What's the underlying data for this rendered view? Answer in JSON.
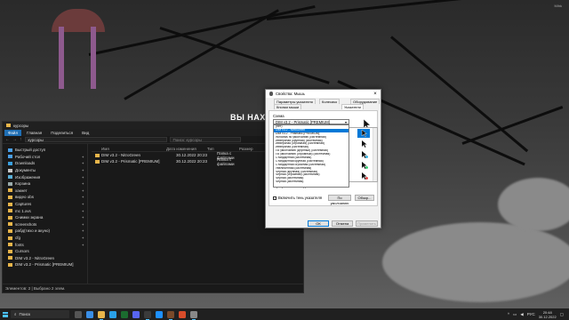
{
  "scene": {
    "title": "ВЫ НАХО",
    "watermark": "Mihk"
  },
  "explorer": {
    "window_title": "курсоры",
    "ribbon": [
      "Файл",
      "Главная",
      "Поделиться",
      "Вид"
    ],
    "address_path": "курсоры",
    "search_placeholder": "Поиск: курсоры",
    "nav": [
      {
        "label": "Быстрый доступ",
        "pinned": false
      },
      {
        "label": "Рабочий стол",
        "pinned": true
      },
      {
        "label": "Downloads",
        "pinned": true
      },
      {
        "label": "Документы",
        "pinned": true
      },
      {
        "label": "Изображения",
        "pinned": true
      },
      {
        "label": "Корзина",
        "pinned": true
      },
      {
        "label": "хакнет",
        "pinned": true
      },
      {
        "label": "видео obs",
        "pinned": true
      },
      {
        "label": "Captures",
        "pinned": true
      },
      {
        "label": "mc 1.xvs",
        "pinned": true
      },
      {
        "label": "Снимки экрана",
        "pinned": true
      },
      {
        "label": "screenshots",
        "pinned": true
      },
      {
        "label": "рабд(тихо и акуно)",
        "pinned": true
      },
      {
        "label": "cfg",
        "pinned": true
      },
      {
        "label": "fonts",
        "pinned": true
      },
      {
        "label": "Cursors",
        "pinned": false
      },
      {
        "label": "DIM v3.2 - NitroGreen",
        "pinned": false
      },
      {
        "label": "DIM v3.2 - Prismatic [PREMIUM]",
        "pinned": false
      }
    ],
    "columns": [
      "Имя",
      "Дата изменения",
      "Тип",
      "Размер"
    ],
    "rows": [
      {
        "name": "DIM v3.2 - NitroGreen",
        "date": "30.12.2022 20:23",
        "type": "Папка с файлами"
      },
      {
        "name": "DIM v3.2 - Prismatic [PREMIUM]",
        "date": "30.12.2022 20:23",
        "type": "Папка с файлами"
      }
    ],
    "status": "Элементов: 2  |  Выбрано 2 элем."
  },
  "dialog": {
    "title": "Свойства: Мышь",
    "tabs_row1": [
      "Параметры указателя",
      "Колесико",
      "Оборудование"
    ],
    "tabs_row2": [
      "Кнопки мыши",
      "Указатели"
    ],
    "scheme_label": "Схема",
    "scheme_value": "DIM v3.2 - Prismatic [PREMIUM]",
    "scheme_options": [
      "(нет)",
      "DIM v3.2 - NitroGreen",
      "DIM v3.2 - Prismatic [PREMIUM]",
      "Windows по умолчанию (системная)",
      "Инверсная (крупная) (системная)",
      "Инверсная (огромная) (системная)",
      "Инверсная (системная)",
      "По умолчанию (крупный) (системная)",
      "По умолчанию (огромный) (системная)",
      "Стандартная (системная)",
      "Стандартная крупная (системная)",
      "Стандартная огромная (системная)",
      "Увеличенная (системная)",
      "Черная (крупная) (системная)",
      "Черная (огромная) (системная)",
      "Черная (системная)",
      "Черная (системная)"
    ],
    "selected_option_index": 1,
    "pointer_list_label": "Графическое выделение",
    "shadow_label": "Включить тень указателя",
    "default_button": "По умолчанию",
    "browse_button": "Обзор...",
    "ok_button": "ОК",
    "cancel_button": "Отмена",
    "apply_button": "Применить"
  },
  "taskbar": {
    "search_placeholder": "Поиск",
    "lang": "РУС",
    "time": "20:48",
    "date": "30.12.2022"
  }
}
